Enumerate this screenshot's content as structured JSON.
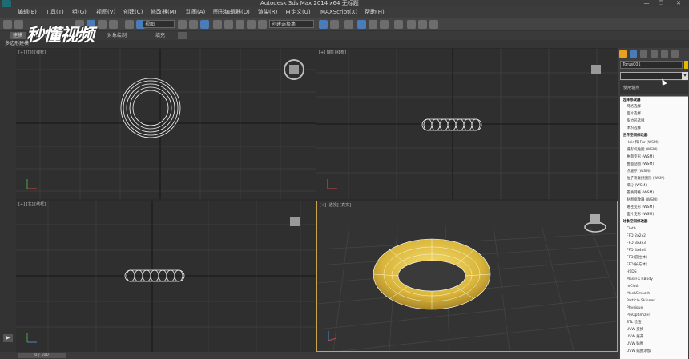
{
  "window": {
    "title": "Autodesk 3ds Max  2014 x64      无标题",
    "minimize": "—",
    "maximize": "❐",
    "close": "✕"
  },
  "menu": [
    "编辑(E)",
    "工具(T)",
    "组(G)",
    "视图(V)",
    "创建(C)",
    "修改器(M)",
    "动画(A)",
    "图形编辑器(D)",
    "渲染(R)",
    "自定义(U)",
    "MAXScript(X)",
    "帮助(H)"
  ],
  "toolbar": {
    "filter_value": "全部",
    "view_value": "视图",
    "selection_set_placeholder": "创建选择集"
  },
  "ribbon": {
    "tabs": [
      "建模",
      "自由形式",
      "选择",
      "对象绘制",
      "填充"
    ],
    "active_tab": "建模",
    "panel_label": "多边形建模"
  },
  "viewports": {
    "top": "[+] [顶] [线框]",
    "front": "[+] [前] [线框]",
    "left": "[+] [左] [线框]",
    "perspective": "[+] [透视] [真实]"
  },
  "command_panel": {
    "object_name": "Torus001",
    "object_color": "#e6b800",
    "stack_item": "使用轴点",
    "categories": [
      {
        "label": "选择修改器",
        "items": [
          "网格选择",
          "面片选择",
          "多边形选择",
          "体积选择"
        ]
      },
      {
        "label": "世界空间修改器",
        "items": [
          "Hair 和 Fur (WSM)",
          "摄影机贴图 (WSM)",
          "曲面变形 (WSM)",
          "曲面贴图 (WSM)",
          "点缓存 (WSM)",
          "粒子流碰撞图形 (WSM)",
          "细分 (WSM)",
          "置换网格 (WSM)",
          "贴图缩放器 (WSM)",
          "路径变形 (WSM)",
          "面片变形 (WSM)"
        ]
      },
      {
        "label": "对象空间修改器",
        "items": [
          "Cloth",
          "FFD 2x2x2",
          "FFD 3x3x3",
          "FFD 4x4x4",
          "FFD(圆柱体)",
          "FFD(长方体)",
          "HSDS",
          "MassFX RBody",
          "mCloth",
          "MeshSmooth",
          "Particle Skinner",
          "Physique",
          "ProOptimizer",
          "STL 检查",
          "UVW 变换",
          "UVW 展开",
          "UVW 贴图",
          "UVW 贴图添加"
        ]
      }
    ]
  },
  "timeline": {
    "frame": "0 / 100"
  },
  "watermark": "秒懂视频"
}
